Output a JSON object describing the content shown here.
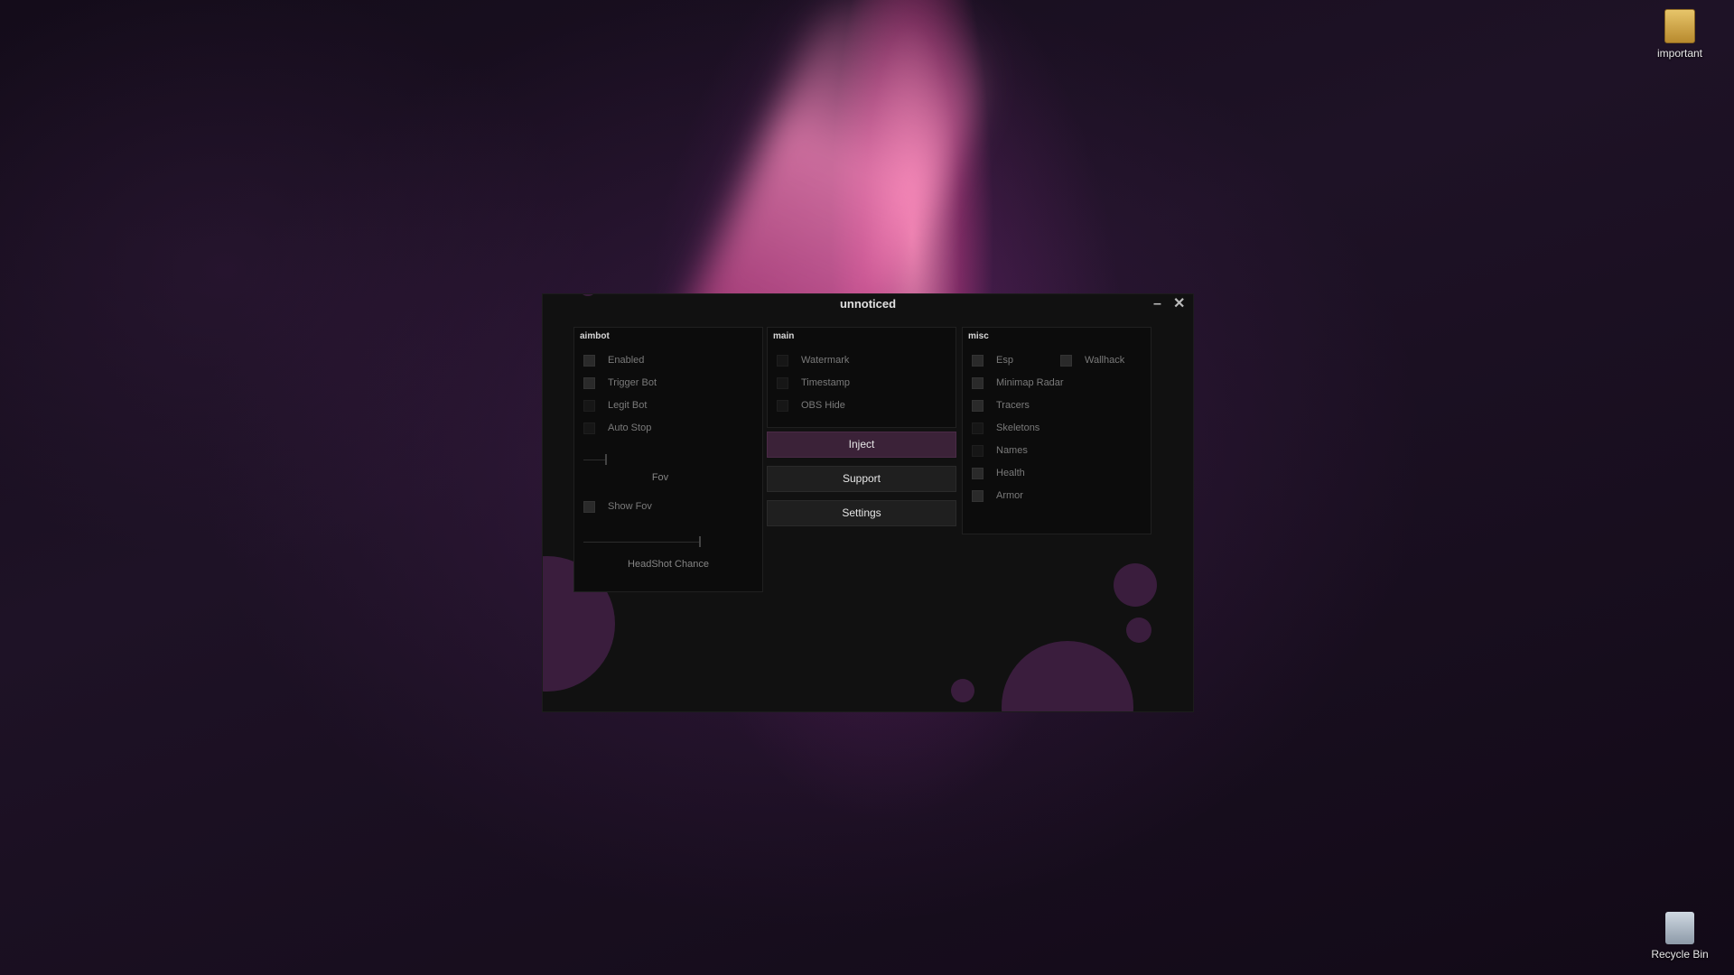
{
  "desktop": {
    "top_icon_label": "important",
    "bottom_icon_label": "Recycle Bin"
  },
  "window": {
    "title": "unnoticed",
    "minimize_glyph": "–",
    "close_glyph": "✕"
  },
  "aimbot": {
    "title": "aimbot",
    "options": [
      "Enabled",
      "Trigger Bot",
      "Legit Bot",
      "Auto Stop"
    ],
    "fov_label": "Fov",
    "show_fov": "Show Fov",
    "headshot_label": "HeadShot Chance"
  },
  "main": {
    "title": "main",
    "options": [
      "Watermark",
      "Timestamp",
      "OBS Hide"
    ]
  },
  "buttons": {
    "inject": "Inject",
    "support": "Support",
    "settings": "Settings"
  },
  "misc": {
    "title": "misc",
    "options": [
      "Esp",
      "Minimap Radar",
      "Tracers",
      "Skeletons",
      "Names",
      "Health",
      "Armor"
    ],
    "wallhack": "Wallhack"
  },
  "colors": {
    "accent": "#3b2238",
    "bubble": "#3a1d3d"
  }
}
